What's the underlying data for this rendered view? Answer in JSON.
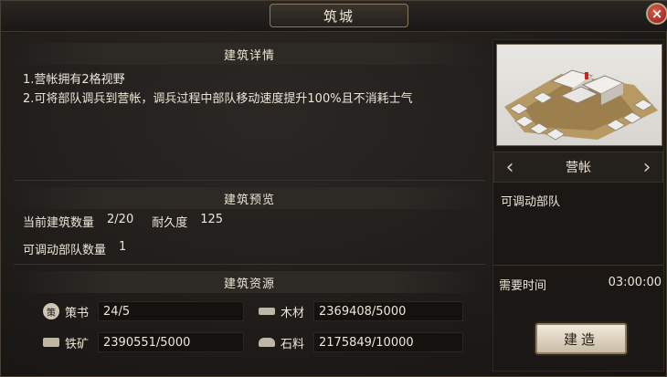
{
  "window": {
    "title": "筑城",
    "close_symbol": "×"
  },
  "details": {
    "header": "建筑详情",
    "lines": [
      "1.营帐拥有2格视野",
      "2.可将部队调兵到营帐，调兵过程中部队移动速度提升100%且不消耗士气"
    ]
  },
  "preview": {
    "header": "建筑预览",
    "count_label": "当前建筑数量",
    "count_value": "2/20",
    "durability_label": "耐久度",
    "durability_value": "125",
    "troops_label": "可调动部队数量",
    "troops_value": "1"
  },
  "resources": {
    "header": "建筑资源",
    "items": [
      {
        "name": "策书",
        "amount": "24/5",
        "icon": "strategy-book-icon",
        "glyph": "策"
      },
      {
        "name": "木材",
        "amount": "2369408/5000",
        "icon": "wood-icon"
      },
      {
        "name": "铁矿",
        "amount": "2390551/5000",
        "icon": "iron-icon"
      },
      {
        "name": "石料",
        "amount": "2175849/10000",
        "icon": "stone-icon"
      }
    ]
  },
  "building": {
    "name": "营帐",
    "description": "可调动部队",
    "time_label": "需要时间",
    "time_value": "03:00:00",
    "build_label": "建造",
    "prev_arrow": "‹",
    "next_arrow": "›"
  },
  "colors": {
    "accent": "#c9bda6",
    "close": "#b3251a"
  }
}
